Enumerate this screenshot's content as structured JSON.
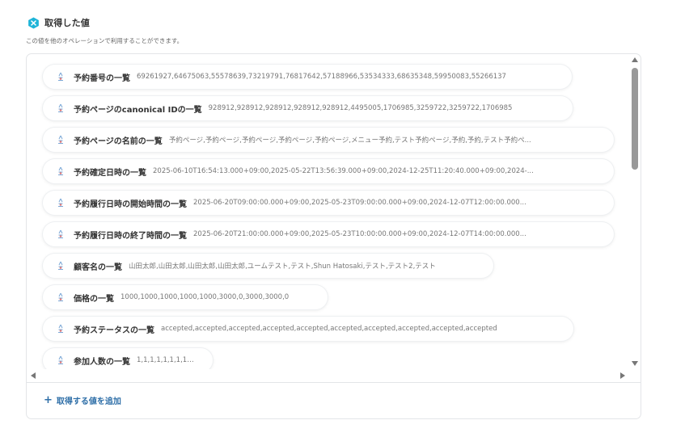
{
  "header": {
    "title": "取得した値",
    "subtitle": "この値を他のオペレーションで利用することができます。"
  },
  "items": [
    {
      "label": "予約番号の一覧",
      "value": "69261927,64675063,55578639,73219791,76817642,57188966,53534333,68635348,59950083,55266137"
    },
    {
      "label": "予約ページのcanonical IDの一覧",
      "value": "928912,928912,928912,928912,928912,4495005,1706985,3259722,3259722,1706985"
    },
    {
      "label": "予約ページの名前の一覧",
      "value": "予約ページ,予約ページ,予約ページ,予約ページ,予約ページ,メニュー予約,テスト予約ページ,予約,予約,テスト予約ペ..."
    },
    {
      "label": "予約確定日時の一覧",
      "value": "2025-06-10T16:54:13.000+09:00,2025-05-22T13:56:39.000+09:00,2024-12-25T11:20:40.000+09:00,2024-..."
    },
    {
      "label": "予約履行日時の開始時間の一覧",
      "value": "2025-06-20T09:00:00.000+09:00,2025-05-23T09:00:00.000+09:00,2024-12-07T12:00:00.000..."
    },
    {
      "label": "予約履行日時の終了時間の一覧",
      "value": "2025-06-20T21:00:00.000+09:00,2025-05-23T10:00:00.000+09:00,2024-12-07T14:00:00.000..."
    },
    {
      "label": "顧客名の一覧",
      "value": "山田太郎,山田太郎,山田太郎,山田太郎,ユームテスト,テスト,Shun Hatosaki,テスト,テスト2,テスト"
    },
    {
      "label": "価格の一覧",
      "value": "1000,1000,1000,1000,1000,3000,0,3000,3000,0"
    },
    {
      "label": "予約ステータスの一覧",
      "value": "accepted,accepted,accepted,accepted,accepted,accepted,accepted,accepted,accepted,accepted"
    },
    {
      "label": "参加人数の一覧",
      "value": "1,1,1,1,1,1,1,1,1,1"
    }
  ],
  "footer": {
    "add_label": "取得する値を追加"
  },
  "colors": {
    "accent": "#2f6fa8",
    "logo": "#1fb4d8"
  },
  "icons": {
    "header": "app-logo-icon",
    "item": "variable-icon",
    "add": "plus-icon"
  }
}
